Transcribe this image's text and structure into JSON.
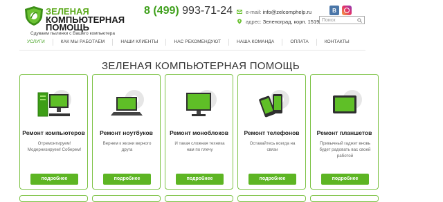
{
  "logo": {
    "line1": "ЗЕЛЕНАЯ",
    "line2": "КОМПЬЮТЕРНАЯ",
    "line3": "ПОМОЩЬ",
    "slogan": "Сдуваем пылинки с Вашего компьютера"
  },
  "header": {
    "phone_code": "8 (499)",
    "phone_number": "993-71-24",
    "email_label": "e-mail:",
    "email_value": "info@zelcomphelp.ru",
    "address_label": "адрес:",
    "address_value": "Зеленоград, корп. 1519",
    "search_placeholder": "Поиск",
    "vk_label": "В"
  },
  "nav": {
    "items": [
      {
        "label": "УСЛУГИ"
      },
      {
        "label": "КАК МЫ РАБОТАЕМ"
      },
      {
        "label": "НАШИ КЛИЕНТЫ"
      },
      {
        "label": "НАС РЕКОМЕНДУЮТ"
      },
      {
        "label": "НАША КОМАНДА"
      },
      {
        "label": "ОПЛАТА"
      },
      {
        "label": "КОНТАКТЫ"
      }
    ]
  },
  "main": {
    "title": "ЗЕЛЕНАЯ КОМПЬЮТЕРНАЯ ПОМОЩЬ",
    "cards": [
      {
        "name": "Ремонт компьютеров",
        "desc": "Отремонтируем! Модернизируем! Соберем!",
        "button": "подробнее"
      },
      {
        "name": "Ремонт ноутбуков",
        "desc": "Вернем к жизни верного друга",
        "button": "подробнее"
      },
      {
        "name": "Ремонт моноблоков",
        "desc": "И такая сложная техника нам по плечу",
        "button": "подробнее"
      },
      {
        "name": "Ремонт телефонов",
        "desc": "Оставайтесь всегда на связи",
        "button": "подробнее"
      },
      {
        "name": "Ремонт планшетов",
        "desc": "Привычный гаджет вновь будет радовать вас своей работой",
        "button": "подробнее"
      }
    ]
  },
  "colors": {
    "accent": "#5db523",
    "card_border": "#7cc244",
    "phone_code": "#3fa01c"
  }
}
